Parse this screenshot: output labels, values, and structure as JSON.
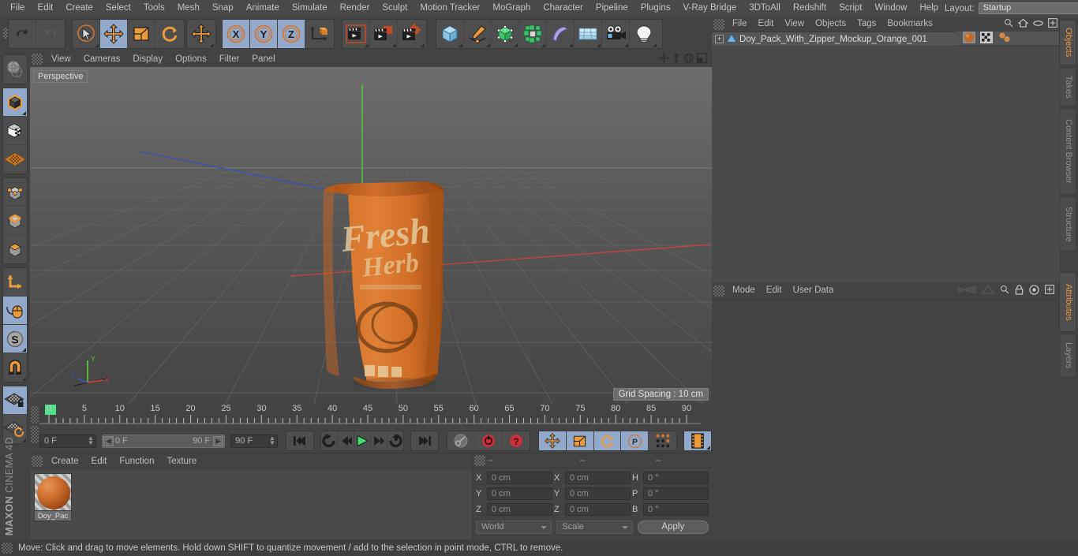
{
  "app": {
    "title": "MAXON CINEMA 4D",
    "brand_line1": "MAXON",
    "brand_line2": "CINEMA 4D"
  },
  "menubar": {
    "items": [
      "File",
      "Edit",
      "Create",
      "Select",
      "Tools",
      "Mesh",
      "Snap",
      "Animate",
      "Simulate",
      "Render",
      "Sculpt",
      "Motion Tracker",
      "MoGraph",
      "Character",
      "Pipeline",
      "Plugins",
      "V-Ray Bridge",
      "3DToAll",
      "Redshift",
      "Script",
      "Window",
      "Help"
    ],
    "layout_label": "Layout:",
    "layout_value": "Startup",
    "search_icon": "search-icon"
  },
  "toolbar": {
    "groups": [
      {
        "name": "undo-redo",
        "buttons": [
          {
            "name": "undo-button",
            "icon": "undo-arrow-icon",
            "active": false,
            "corner": false
          },
          {
            "name": "redo-button",
            "icon": "redo-arrow-icon",
            "active": false,
            "corner": false
          }
        ]
      },
      {
        "name": "transform-tools",
        "buttons": [
          {
            "name": "live-selection-tool",
            "icon": "cursor-circle-icon",
            "active": false,
            "corner": true
          },
          {
            "name": "move-tool",
            "icon": "move-arrows-icon",
            "active": true,
            "corner": false
          },
          {
            "name": "scale-tool",
            "icon": "scale-box-icon",
            "active": false,
            "corner": false
          },
          {
            "name": "rotate-tool",
            "icon": "rotate-arc-icon",
            "active": false,
            "corner": false
          }
        ]
      },
      {
        "name": "world-axis-tool",
        "buttons": [
          {
            "name": "world-move-tool",
            "icon": "move-arrows-icon",
            "active": false,
            "corner": true
          }
        ]
      },
      {
        "name": "axis-locks",
        "buttons": [
          {
            "name": "lock-x-axis",
            "icon": "x-axis-icon",
            "label": "X",
            "active": true,
            "corner": false
          },
          {
            "name": "lock-y-axis",
            "icon": "y-axis-icon",
            "label": "Y",
            "active": true,
            "corner": false
          },
          {
            "name": "lock-z-axis",
            "icon": "z-axis-icon",
            "label": "Z",
            "active": true,
            "corner": false
          },
          {
            "name": "world-object-coordinates",
            "icon": "world-coord-cube-icon",
            "active": false,
            "corner": false
          }
        ]
      },
      {
        "name": "render-tools",
        "buttons": [
          {
            "name": "render-view-button",
            "icon": "render-clapper-icon",
            "active": false,
            "corner": true
          },
          {
            "name": "render-to-picture-viewer-button",
            "icon": "render-picture-icon",
            "active": false,
            "corner": true
          },
          {
            "name": "render-settings-button",
            "icon": "render-settings-gear-icon",
            "active": false,
            "corner": true
          }
        ]
      },
      {
        "name": "create-objects",
        "buttons": [
          {
            "name": "add-cube-button",
            "icon": "cube-icon",
            "active": false,
            "corner": true
          },
          {
            "name": "add-spline-button",
            "icon": "pen-spline-icon",
            "active": false,
            "corner": true
          },
          {
            "name": "add-nurbs-button",
            "icon": "green-cube-icon",
            "active": false,
            "corner": true
          },
          {
            "name": "add-array-button",
            "icon": "array-cluster-icon",
            "active": false,
            "corner": true
          },
          {
            "name": "add-bend-deformer-button",
            "icon": "bend-deformer-icon",
            "active": false,
            "corner": true
          },
          {
            "name": "add-floor-button",
            "icon": "floor-grid-icon",
            "active": false,
            "corner": true
          },
          {
            "name": "add-camera-button",
            "icon": "camera-icon",
            "active": false,
            "corner": true
          },
          {
            "name": "add-light-button",
            "icon": "light-bulb-icon",
            "active": false,
            "corner": true
          }
        ]
      }
    ]
  },
  "left_toolbar": {
    "groups": [
      {
        "name": "group-texture",
        "buttons": [
          {
            "name": "texture-axis-tool",
            "icon": "globe-texture-icon",
            "active": false,
            "corner": false
          }
        ]
      },
      {
        "name": "group-selection-mode",
        "buttons": [
          {
            "name": "model-mode-button",
            "icon": "model-cube-icon",
            "active": true,
            "corner": true
          },
          {
            "name": "texture-mode-button",
            "icon": "checker-cube-icon",
            "active": false,
            "corner": false
          },
          {
            "name": "texture-axis-mode-button",
            "icon": "orange-grid-plane-icon",
            "active": false,
            "corner": false
          }
        ]
      },
      {
        "name": "group-component-mode",
        "buttons": [
          {
            "name": "points-mode-button",
            "icon": "points-cube-icon",
            "active": false,
            "corner": false
          },
          {
            "name": "edges-mode-button",
            "icon": "edges-cube-icon",
            "active": false,
            "corner": false
          },
          {
            "name": "polygons-mode-button",
            "icon": "polygons-cube-icon",
            "active": false,
            "corner": false
          }
        ]
      },
      {
        "name": "group-axis-snap",
        "buttons": [
          {
            "name": "enable-axis-modification-button",
            "icon": "axis-L-icon",
            "active": false,
            "corner": false
          },
          {
            "name": "enable-snapping-button",
            "icon": "mouse-cursor-icon",
            "active": true,
            "corner": false
          },
          {
            "name": "soft-selection-button",
            "icon": "s-circle-icon",
            "active": true,
            "corner": true
          },
          {
            "name": "magnet-tool-button",
            "icon": "magnet-icon",
            "active": false,
            "corner": true
          }
        ]
      },
      {
        "name": "group-workplane",
        "buttons": [
          {
            "name": "lock-workplane-button",
            "icon": "workplane-lock-icon",
            "active": true,
            "corner": false
          },
          {
            "name": "workplane-rotate-button",
            "icon": "workplane-rotate-icon",
            "active": false,
            "corner": true
          }
        ]
      }
    ]
  },
  "viewport": {
    "menu": [
      "View",
      "Cameras",
      "Display",
      "Options",
      "Filter",
      "Panel"
    ],
    "label": "Perspective",
    "grid_spacing": "Grid Spacing : 10 cm",
    "nav_icons": [
      "pan-icon",
      "dolly-icon",
      "rotate-icon",
      "maximize-viewport-icon"
    ],
    "axis_gizmo": {
      "x": "X",
      "y": "Y",
      "z": "Z",
      "x_color": "#d14a4a",
      "y_color": "#4ad14a",
      "z_color": "#4a6ad1"
    },
    "axes": {
      "x_color": "#c8403c",
      "y_color": "#55c23a",
      "z_color": "#3b52b8"
    },
    "model": {
      "name": "Doy Pack With Zipper Mockup Orange",
      "body_color": "#cd6a28",
      "highlight_color": "#e2853f",
      "shadow_color": "#9a4614",
      "label_text": "Fresh",
      "label_color": "#e8cf9e"
    }
  },
  "timeline": {
    "ticks": [
      0,
      5,
      10,
      15,
      20,
      25,
      30,
      35,
      40,
      45,
      50,
      55,
      60,
      65,
      70,
      75,
      80,
      85,
      90
    ],
    "current_frame_marker": 0,
    "fields": {
      "current_frame": "0 F",
      "range_start": "0 F",
      "range_end": "90 F",
      "max_frame": "90 F",
      "end_frame_right": "0 F"
    },
    "transport": [
      {
        "name": "go-to-start-button",
        "icon": "skip-start-icon"
      },
      {
        "name": "play-reverse-loop-button",
        "icon": "loop-back-icon"
      },
      {
        "name": "step-back-button",
        "icon": "step-back-icon"
      },
      {
        "name": "play-button",
        "icon": "play-icon"
      },
      {
        "name": "step-forward-button",
        "icon": "step-forward-icon"
      },
      {
        "name": "loop-forward-button",
        "icon": "loop-forward-icon"
      },
      {
        "name": "go-to-end-button",
        "icon": "skip-end-icon"
      }
    ],
    "keyframe_tools": [
      {
        "name": "autokeying-button",
        "icon": "key-icon",
        "active": false
      },
      {
        "name": "record-active-objects-button",
        "icon": "record-circle-icon",
        "active": false
      },
      {
        "name": "keyframe-selection-button",
        "icon": "question-circle-icon",
        "active": false
      }
    ],
    "record_toggles": [
      {
        "name": "record-position-button",
        "icon": "move-arrows-icon",
        "active": true
      },
      {
        "name": "record-scale-button",
        "icon": "scale-box-icon",
        "active": true
      },
      {
        "name": "record-rotation-button",
        "icon": "rotate-arc-icon",
        "active": true
      },
      {
        "name": "record-parameter-button",
        "icon": "p-circle-icon",
        "active": true
      },
      {
        "name": "record-pla-button",
        "icon": "dots-grid-icon",
        "active": false
      },
      {
        "name": "timeline-filmstrip-button",
        "icon": "filmstrip-icon",
        "active": true
      }
    ]
  },
  "material_manager": {
    "menu": [
      "Create",
      "Edit",
      "Function",
      "Texture"
    ],
    "materials": [
      {
        "name": "Doy_Pac",
        "full_name": "Doy_Pack"
      }
    ]
  },
  "coordinates": {
    "header_dashes": [
      "--",
      "--",
      "--"
    ],
    "rows": [
      {
        "pos_label": "X",
        "pos_value": "0 cm",
        "size_label": "X",
        "size_value": "0 cm",
        "rot_label": "H",
        "rot_value": "0 °"
      },
      {
        "pos_label": "Y",
        "pos_value": "0 cm",
        "size_label": "Y",
        "size_value": "0 cm",
        "rot_label": "P",
        "rot_value": "0 °"
      },
      {
        "pos_label": "Z",
        "pos_value": "0 cm",
        "size_label": "Z",
        "size_value": "0 cm",
        "rot_label": "B",
        "rot_value": "0 °"
      }
    ],
    "system_dropdown": "World",
    "mode_dropdown": "Scale",
    "apply_button": "Apply"
  },
  "object_manager": {
    "menu": [
      "File",
      "Edit",
      "View",
      "Objects",
      "Tags",
      "Bookmarks"
    ],
    "header_icons": [
      "search-icon",
      "home-icon",
      "ellipse-icon",
      "expand-icon"
    ],
    "objects": [
      {
        "name": "Doy_Pack_With_Zipper_Mockup_Orange_001",
        "icon": "polygon-object-icon",
        "visible_dot_color": "#25d196",
        "tags": [
          "material-tag",
          "uvw-tag",
          "texture-tag"
        ]
      }
    ]
  },
  "attributes": {
    "menu": [
      "Mode",
      "Edit",
      "User Data"
    ],
    "icons": [
      "nav-back-icon",
      "nav-forward-icon",
      "search-icon",
      "lock-icon",
      "target-icon",
      "expand-icon"
    ]
  },
  "vertical_tabs": {
    "upper": [
      {
        "label": "Objects",
        "active": true
      },
      {
        "label": "Takes",
        "active": false
      },
      {
        "label": "Content Browser",
        "active": false
      },
      {
        "label": "Structure",
        "active": false
      }
    ],
    "lower": [
      {
        "label": "Attributes",
        "active": true
      },
      {
        "label": "Layers",
        "active": false
      }
    ]
  },
  "statusbar": {
    "message": "Move: Click and drag to move elements. Hold down SHIFT to quantize movement / add to the selection in point mode, CTRL to remove."
  }
}
